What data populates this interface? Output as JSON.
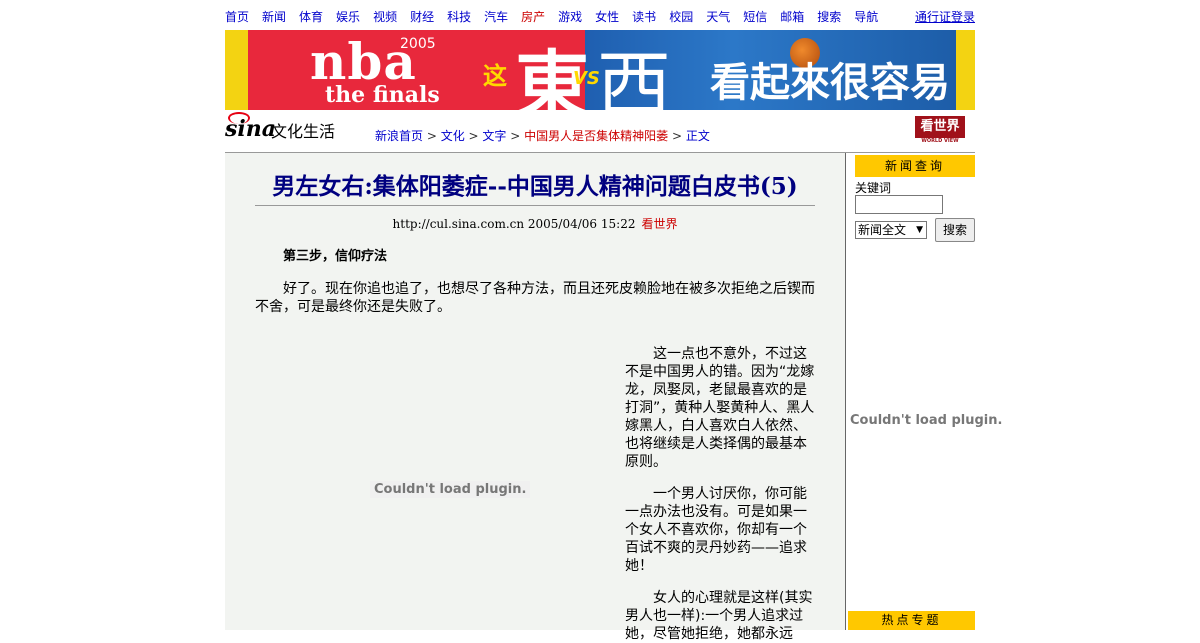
{
  "top_nav": {
    "items": [
      "首页",
      "新闻",
      "体育",
      "娱乐",
      "视频",
      "财经",
      "科技",
      "汽车",
      "房产",
      "游戏",
      "女性",
      "读书",
      "校园",
      "天气",
      "短信",
      "邮箱",
      "搜索",
      "导航"
    ],
    "login": "通行证登录"
  },
  "banner": {
    "nba": "nba",
    "year": "2005",
    "finals": "the finals",
    "zhe": "这",
    "dong": "東",
    "vs": "VS",
    "xi": "西",
    "slogan": "看起來很容易"
  },
  "logo": {
    "brand": "sina",
    "channel": "文化生活"
  },
  "breadcrumb": {
    "home": "新浪首页",
    "culture": "文化",
    "text": "文字",
    "article": "中国男人是否集体精神阳萎",
    "current": "正文",
    "sep": " > "
  },
  "kanshijie_logo": {
    "text": "看世界",
    "sub": "WORLD VIEW"
  },
  "article": {
    "title": "男左女右:集体阳萎症--中国男人精神问题白皮书(5)",
    "meta_url_date": "http://cul.sina.com.cn 2005/04/06 15:22",
    "meta_source": "看世界",
    "step_heading": "第三步，信仰疗法",
    "para1": "好了。现在你追也追了，也想尽了各种方法，而且还死皮赖脸地在被多次拒绝之后锲而不舍，可是最终你还是失败了。",
    "plugin_message": "Couldn't load plugin.",
    "para2": "这一点也不意外，不过这不是中国男人的错。因为“龙嫁龙，凤娶凤，老鼠最喜欢的是打洞”，黄种人娶黄种人、黑人嫁黑人，白人喜欢白人依然、也将继续是人类择偶的最基本原则。",
    "para3": "一个男人讨厌你，你可能一点办法也没有。可是如果一个女人不喜欢你，你却有一个百试不爽的灵丹妙药——追求她！",
    "para4": "女人的心理就是这样(其实男人也一样):一个男人追求过她，尽管她拒绝，她都永远"
  },
  "sidebar": {
    "search_title": "新闻查询",
    "keyword_label": "关键词",
    "keyword_value": "",
    "scope_selected": "新闻全文",
    "search_button": "搜索",
    "plugin_message": "Couldn't load plugin.",
    "hot_title": "热点专题"
  }
}
